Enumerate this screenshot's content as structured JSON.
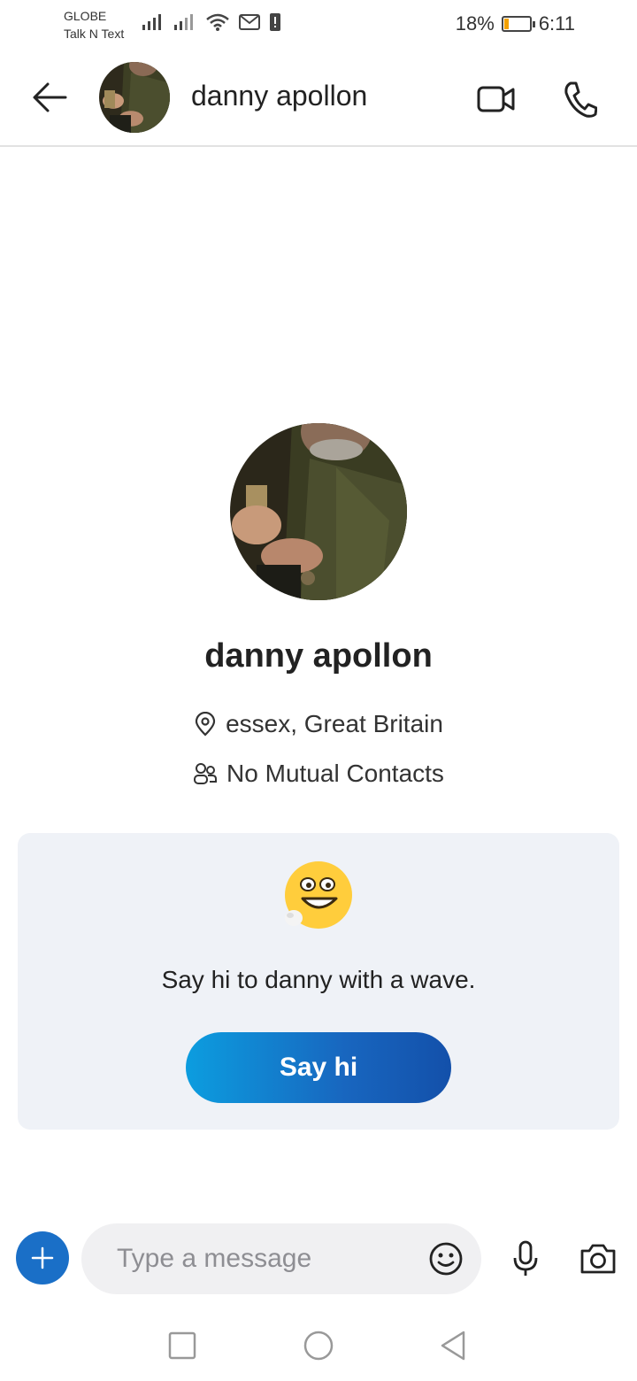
{
  "status_bar": {
    "carrier_line1": "GLOBE",
    "carrier_line2": "Talk N Text",
    "battery": "18%",
    "battery_level": 0.18,
    "time": "6:11"
  },
  "header": {
    "contact_name": "danny apollon"
  },
  "profile": {
    "name": "danny apollon",
    "location": "essex, Great Britain",
    "mutual_contacts": "No Mutual Contacts"
  },
  "wave_card": {
    "message": "Say hi to danny with a wave.",
    "button_label": "Say hi"
  },
  "compose": {
    "placeholder": "Type a message"
  },
  "colors": {
    "accent": "#1a6fc7",
    "card_bg": "#eff2f7",
    "button_gradient_start": "#0c9ddf",
    "button_gradient_end": "#1350aa",
    "battery_fill": "#f2a100"
  },
  "icons": {
    "back": "arrow-left-icon",
    "video": "video-camera-icon",
    "call": "phone-icon",
    "location": "location-pin-icon",
    "mutual": "people-icon",
    "add": "plus-icon",
    "emoji": "smiley-icon",
    "mic": "microphone-icon",
    "camera": "camera-icon",
    "nav_recent": "square-icon",
    "nav_home": "circle-icon",
    "nav_back": "triangle-back-icon"
  }
}
